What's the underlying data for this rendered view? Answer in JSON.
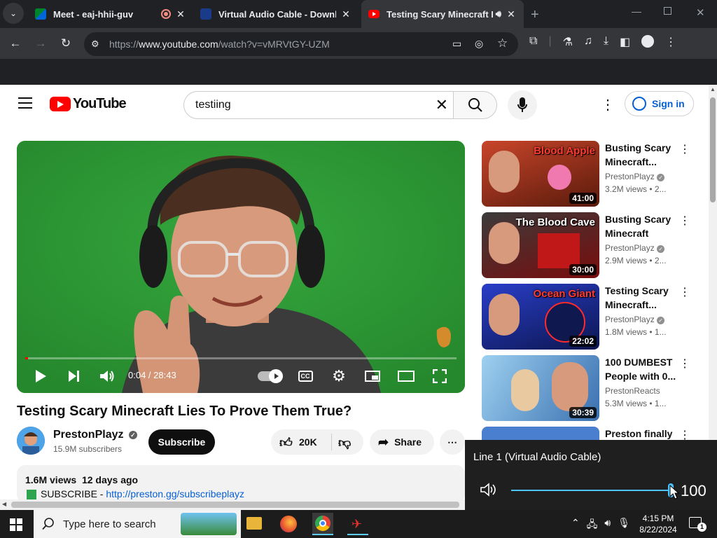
{
  "browser": {
    "tabs": [
      {
        "title": "Meet - eaj-hhii-guv",
        "favicon_color": "#34a853",
        "recording": true
      },
      {
        "title": "Virtual Audio Cable - Download",
        "favicon_color": "#1a3a8a"
      },
      {
        "title": "Testing Scary Minecraft Lies",
        "favicon_color": "#ff0000",
        "active": true,
        "audio": true
      }
    ],
    "new_tab_label": "+",
    "url_prefix": "https://",
    "url_host": "www.youtube.com",
    "url_path": "/watch?v=vMRVtGY-UZM"
  },
  "youtube": {
    "logo_text": "YouTube",
    "search_value": "testiing",
    "sign_in_label": "Sign in"
  },
  "player": {
    "time_current": "0:04",
    "time_separator": " / ",
    "time_total": "28:43",
    "progress_fraction": 0.0023
  },
  "video": {
    "title": "Testing Scary Minecraft Lies To Prove Them True?",
    "channel": "PrestonPlayz",
    "subscribers": "15.9M subscribers",
    "subscribe_label": "Subscribe",
    "likes": "20K",
    "share_label": "Share",
    "more_label": "⋯",
    "views": "1.6M views",
    "age": "12 days ago",
    "desc_prefix": "SUBSCRIBE - ",
    "desc_link": "http://preston.gg/subscribeplayz"
  },
  "recommendations": [
    {
      "title": "Busting Scary Minecraft...",
      "channel": "PrestonPlayz",
      "views": "3.2M views",
      "age": "2...",
      "duration": "41:00",
      "thumb_text": "Blood Apple",
      "thumb_color": "#b8321a"
    },
    {
      "title": "Busting Scary Minecraft Lies...",
      "channel": "PrestonPlayz",
      "views": "2.9M views",
      "age": "2...",
      "duration": "30:00",
      "thumb_text": "The Blood Cave",
      "thumb_color": "#7a0c0c"
    },
    {
      "title": "Testing Scary Minecraft...",
      "channel": "PrestonPlayz",
      "views": "1.8M views",
      "age": "1...",
      "duration": "22:02",
      "thumb_text": "Ocean Giant",
      "thumb_color": "#1a2a9a"
    },
    {
      "title": "100 DUMBEST People with 0...",
      "channel": "PrestonReacts",
      "views": "5.3M views",
      "age": "1...",
      "duration": "30:39",
      "thumb_text": "",
      "thumb_color": "#4a8ac0"
    },
    {
      "title": "Preston finally",
      "channel": "",
      "views": "",
      "age": "",
      "duration": "",
      "thumb_text": "",
      "thumb_color": "#4a7fd0"
    }
  ],
  "volume_flyout": {
    "device": "Line 1 (Virtual Audio Cable)",
    "level": "100",
    "level_fraction": 1.0
  },
  "taskbar": {
    "search_placeholder": "Type here to search",
    "time": "4:15 PM",
    "date": "8/22/2024",
    "notification_count": "1"
  }
}
